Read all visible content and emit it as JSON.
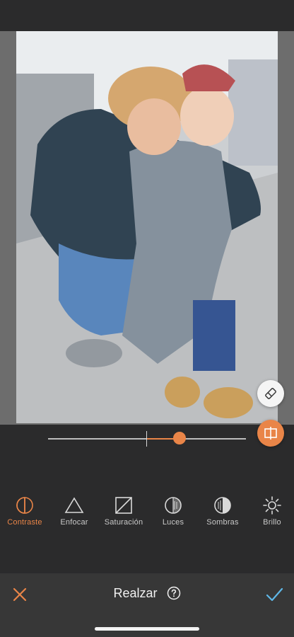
{
  "slider": {
    "value": 0.33,
    "min": -1,
    "max": 1
  },
  "tools": [
    {
      "id": "contraste",
      "label": "Contraste",
      "active": true,
      "icon": "contrast-icon"
    },
    {
      "id": "enfocar",
      "label": "Enfocar",
      "active": false,
      "icon": "sharpen-triangle-icon"
    },
    {
      "id": "saturacion",
      "label": "Saturación",
      "active": false,
      "icon": "saturation-icon"
    },
    {
      "id": "luces",
      "label": "Luces",
      "active": false,
      "icon": "highlights-icon"
    },
    {
      "id": "sombras",
      "label": "Sombras",
      "active": false,
      "icon": "shadows-icon"
    },
    {
      "id": "brillo",
      "label": "Brillo",
      "active": false,
      "icon": "brightness-sun-icon"
    }
  ],
  "bottom_bar": {
    "title": "Realzar",
    "cancel_icon": "close-icon",
    "confirm_icon": "checkmark-icon",
    "help_icon": "help-icon"
  },
  "floating": {
    "eraser_icon": "eraser-icon",
    "compare_icon": "compare-icon"
  },
  "colors": {
    "accent": "#e98548",
    "confirm": "#5fb8e8",
    "background": "#2b2b2c",
    "bar": "#373737"
  }
}
